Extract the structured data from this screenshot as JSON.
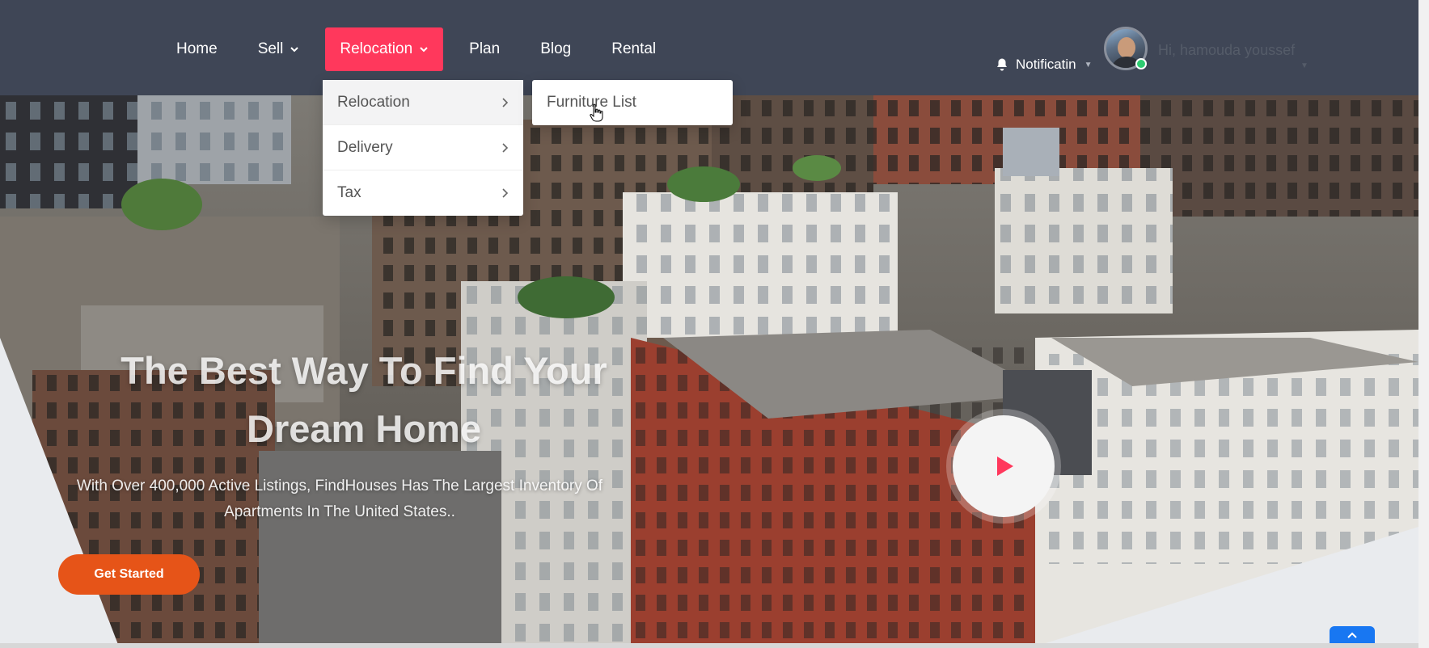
{
  "nav": {
    "items": [
      {
        "label": "Home",
        "has_caret": false
      },
      {
        "label": "Sell",
        "has_caret": true
      },
      {
        "label": "Relocation",
        "has_caret": true,
        "active": true
      },
      {
        "label": "Plan",
        "has_caret": false
      },
      {
        "label": "Blog",
        "has_caret": false
      },
      {
        "label": "Rental",
        "has_caret": false
      }
    ]
  },
  "header": {
    "notification_label": "Notificatin",
    "greeting": "Hi, hamouda youssef"
  },
  "dropdown": {
    "items": [
      {
        "label": "Relocation"
      },
      {
        "label": "Delivery"
      },
      {
        "label": "Tax"
      }
    ],
    "submenu_item": "Furniture List"
  },
  "hero": {
    "title_line1": "The Best Way To Find Your",
    "title_line2": "Dream Home",
    "subtitle_line1": "With Over 400,000 Active Listings, FindHouses Has The Largest Inventory Of",
    "subtitle_line2": "Apartments In The United States..",
    "cta_label": "Get Started"
  },
  "colors": {
    "header_bg": "#3f4656",
    "accent": "#ff385c",
    "cta": "#e65418",
    "scroll_top": "#1877f2",
    "online": "#2ecc71"
  },
  "icons": {
    "bell": "bell-icon",
    "play": "play-icon",
    "chevron_right": "chevron-right-icon",
    "chevron_down": "chevron-down-icon",
    "arrow_up": "arrow-up-icon"
  }
}
